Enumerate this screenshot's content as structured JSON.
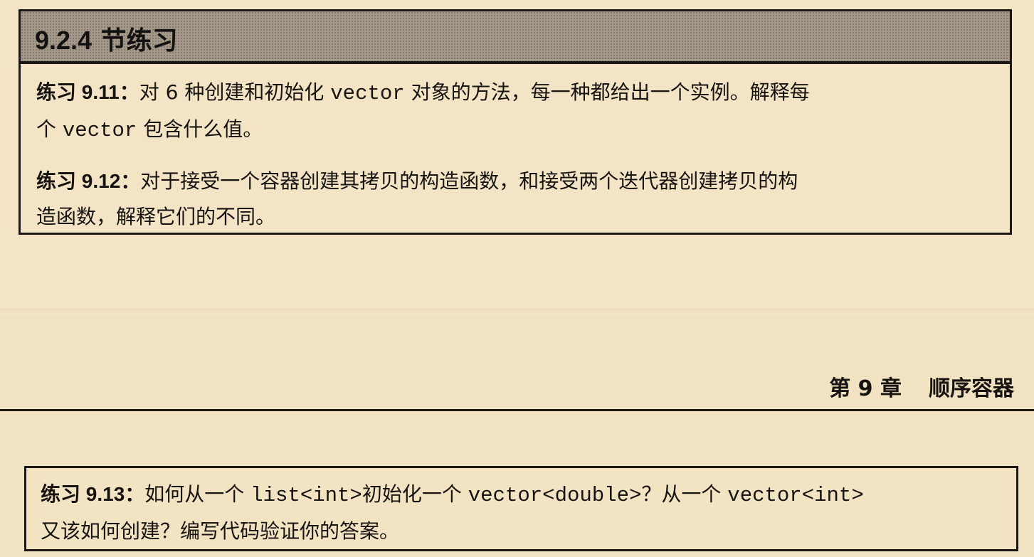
{
  "section": {
    "title_number": "9.2.4",
    "title_text": "节练习"
  },
  "exercises": [
    {
      "label": "练习 9.11",
      "colon": "：",
      "lines": [
        {
          "pre": "对 6 种创建和初始化 ",
          "code": "vector",
          "post": " 对象的方法，每一种都给出一个实例。解释每"
        },
        {
          "pre": "个 ",
          "code": "vector",
          "post": " 包含什么值。"
        }
      ]
    },
    {
      "label": "练习 9.12",
      "colon": "：",
      "lines": [
        "对于接受一个容器创建其拷贝的构造函数，和接受两个迭代器创建拷贝的构",
        "造函数，解释它们的不同。"
      ]
    },
    {
      "label": "练习 9.13",
      "colon": "：",
      "lines": [
        {
          "pre": "如何从一个 ",
          "code1": "list<int>",
          "mid": "初始化一个 ",
          "code2": "vector<double>",
          "mid2": "？从一个 ",
          "code3": "vector<int>"
        },
        "又该如何创建？编写代码验证你的答案。"
      ]
    }
  ],
  "running_head": {
    "chapter": "第 9 章",
    "title": "顺序容器"
  }
}
